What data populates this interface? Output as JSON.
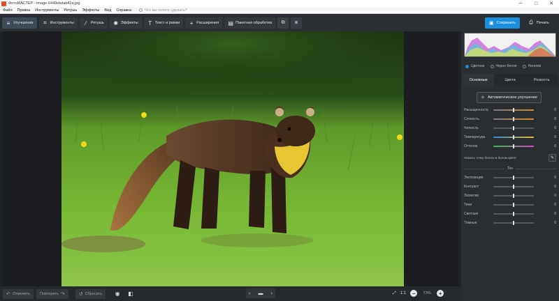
{
  "titlebar": {
    "title": "ФотоМАСТЕР - image-6449ebdab42a.jpg",
    "minimize": "─",
    "maximize": "□",
    "close": "✕"
  },
  "menu": {
    "items": [
      "Файл",
      "Правка",
      "Инструменты",
      "Ретушь",
      "Эффекты",
      "Вид",
      "Справка"
    ],
    "search_placeholder": "Что вы хотите сделать?"
  },
  "toolbar": {
    "tabs": [
      {
        "label": "Улучшения",
        "icon": "sliders-icon",
        "glyph": "≡",
        "active": true
      },
      {
        "label": "Инструменты",
        "icon": "crop-icon",
        "glyph": "⌗",
        "active": false
      },
      {
        "label": "Ретушь",
        "icon": "brush-icon",
        "glyph": "⁄",
        "active": false
      },
      {
        "label": "Эффекты",
        "icon": "effects-icon",
        "glyph": "✺",
        "active": false
      },
      {
        "label": "Текст и рамки",
        "icon": "text-icon",
        "glyph": "T",
        "active": false
      },
      {
        "label": "Расширения",
        "icon": "plus-icon",
        "glyph": "+",
        "active": false
      },
      {
        "label": "Пакетная обработка",
        "icon": "batch-icon",
        "glyph": "▤",
        "active": false
      }
    ],
    "save_label": "Сохранить",
    "print_label": "Печать",
    "colors": {
      "accent": "#1a8fdd",
      "toolbar_bg": "#2b2f33"
    }
  },
  "panel": {
    "modes": [
      {
        "label": "Цветное",
        "selected": true
      },
      {
        "label": "Черно-белое",
        "selected": false
      },
      {
        "label": "Негатив",
        "selected": false
      }
    ],
    "tabs": [
      {
        "label": "Основные",
        "active": true
      },
      {
        "label": "Цвета",
        "active": false
      },
      {
        "label": "Резкость",
        "active": false
      }
    ],
    "auto_label": "Автоматическое улучшение",
    "color_sliders": [
      {
        "label": "Насыщенность",
        "value": "0"
      },
      {
        "label": "Сочность",
        "value": "0"
      },
      {
        "label": "Четкость",
        "value": "0"
      },
      {
        "label": "Температура",
        "value": "0"
      },
      {
        "label": "Оттенок",
        "value": "0"
      }
    ],
    "picker_label": "Указать точку белого в белом цвете",
    "tone_title": "Тон",
    "tone_sliders": [
      {
        "label": "Экспозиция",
        "value": "0"
      },
      {
        "label": "Контраст",
        "value": "0"
      },
      {
        "label": "Засветки",
        "value": "0"
      },
      {
        "label": "Тени",
        "value": "0"
      },
      {
        "label": "Светлые",
        "value": "0"
      },
      {
        "label": "Тёмные",
        "value": "0"
      }
    ]
  },
  "bottom": {
    "undo_label": "Отменить",
    "redo_label": "Повторить",
    "reset_label": "Сбросить",
    "fit_label": "1:1",
    "zoom_value": "73%",
    "nav_prev": "‹",
    "nav_next": "›"
  }
}
